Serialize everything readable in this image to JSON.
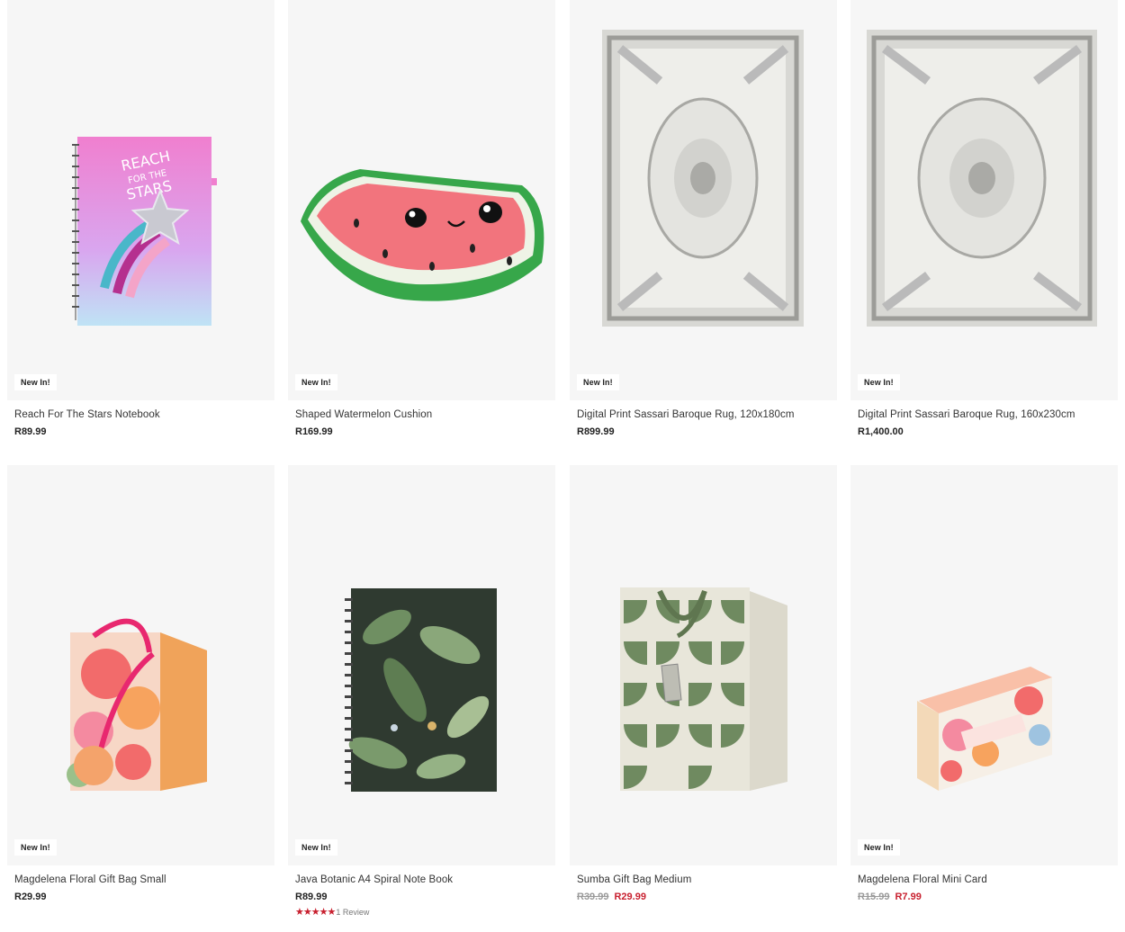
{
  "badge_text": "New In!",
  "products": [
    {
      "name": "Reach For The Stars Notebook",
      "price": "R89.99",
      "badge": "New In!",
      "image": "notebook-stars-image"
    },
    {
      "name": "Shaped Watermelon Cushion",
      "price": "R169.99",
      "badge": "New In!",
      "image": "watermelon-cushion-image"
    },
    {
      "name": "Digital Print Sassari Baroque Rug, 120x180cm",
      "price": "R899.99",
      "badge": "New In!",
      "image": "rug-image"
    },
    {
      "name": "Digital Print Sassari Baroque Rug, 160x230cm",
      "price": "R1,400.00",
      "badge": "New In!",
      "image": "rug-image"
    },
    {
      "name": "Magdelena Floral Gift Bag Small",
      "price": "R29.99",
      "badge": "New In!",
      "image": "floral-gift-bag-image"
    },
    {
      "name": "Java Botanic A4 Spiral Note Book",
      "price": "R89.99",
      "badge": "New In!",
      "image": "botanic-notebook-image",
      "stars": "★★★★★",
      "reviews": "1 Review"
    },
    {
      "name": "Sumba Gift Bag Medium",
      "was_price": "R39.99",
      "sale_price": "R29.99",
      "image": "green-gift-bag-image"
    },
    {
      "name": "Magdelena Floral Mini Card",
      "was_price": "R15.99",
      "sale_price": "R7.99",
      "badge": "New In!",
      "image": "floral-card-image"
    }
  ],
  "colors": {
    "sale": "#c8202f",
    "card_bg": "#f6f6f6",
    "strike": "#999999"
  }
}
